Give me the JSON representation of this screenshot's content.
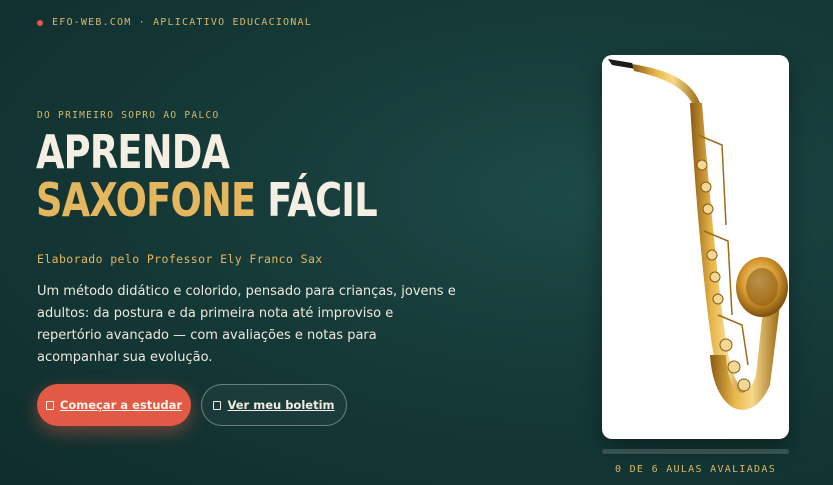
{
  "brand": {
    "text": "EFO-WEB.COM · APLICATIVO EDUCACIONAL",
    "dot_color": "#e8564a"
  },
  "hero": {
    "eyebrow": "DO PRIMEIRO SOPRO AO PALCO",
    "title_line1": "APRENDA",
    "title_accent": "SAXOFONE",
    "title_rest": " FÁCIL",
    "byline": "Elaborado pelo Professor Ely Franco Sax",
    "description": "Um método didático e colorido, pensado para crianças, jovens e adultos: da postura e da primeira nota até improviso e repertório avançado — com avaliações e notas para acompanhar sua evolução."
  },
  "actions": {
    "primary_label": "Começar a estudar",
    "primary_icon": "book-icon",
    "secondary_label": "Ver meu boletim",
    "secondary_icon": "report-icon"
  },
  "illustration": {
    "subject": "saxophone-image"
  },
  "progress": {
    "completed": 0,
    "total": 6,
    "fraction": 0,
    "label": "0 DE 6 AULAS AVALIADAS"
  },
  "colors": {
    "accent_gold": "#e4b75e",
    "primary_button": "#e25a45",
    "background": "#153a38"
  }
}
